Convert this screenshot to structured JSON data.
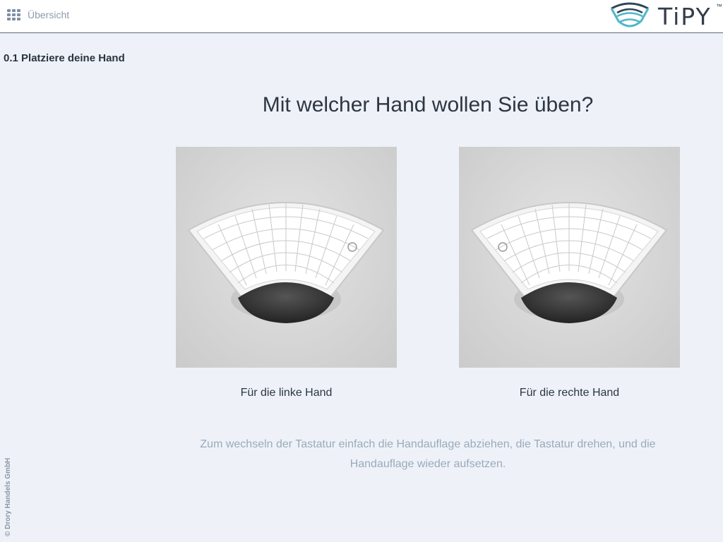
{
  "header": {
    "overview_label": "Übersicht",
    "logo_text": "TiPY",
    "logo_tm": "™"
  },
  "section_title": "0.1 Platziere deine Hand",
  "question": "Mit welcher Hand wollen Sie üben?",
  "options": [
    {
      "caption": "Für die linke Hand"
    },
    {
      "caption": "Für die rechte Hand"
    }
  ],
  "hint": "Zum wechseln der Tastatur einfach die Handauflage abziehen, die Tastatur drehen, und die Handauflage wieder aufsetzen.",
  "copyright": "© Drory Handels GmbH",
  "colors": {
    "background": "#eef2f8",
    "header_border": "#5a6878",
    "logo_teal": "#4fb7c8",
    "logo_dark": "#2f4658",
    "hint_text": "#9aaabb"
  },
  "icons": {
    "overview": "grid-icon",
    "logo": "tipy-logo-icon",
    "keyboard": "keyboard-image"
  }
}
